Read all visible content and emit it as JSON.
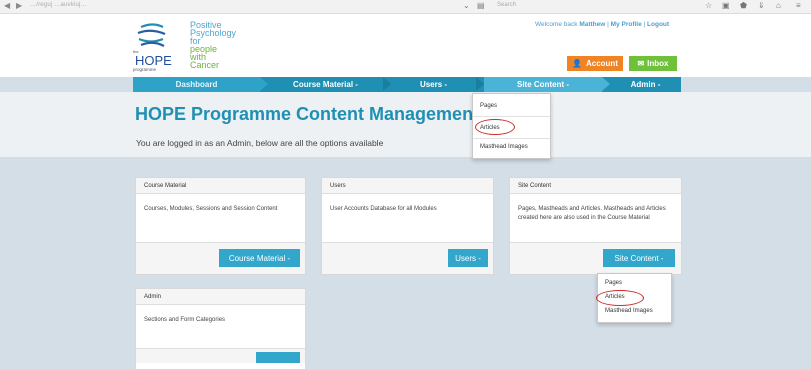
{
  "browser": {
    "url": "…/reguj …auvkiuj…",
    "search_placeholder": "Search"
  },
  "header": {
    "logo": {
      "word": "HOPE",
      "small_top": "the",
      "small_bottom": "programme",
      "tagline": [
        "Positive",
        "Psychology",
        "for",
        "people",
        "with",
        "Cancer"
      ]
    },
    "welcome_prefix": "Welcome back",
    "welcome_user": "Matthew",
    "my_profile": "My Profile",
    "logout": "Logout",
    "sep": "|",
    "account_label": "Account",
    "inbox_label": "Inbox"
  },
  "nav": {
    "items": [
      {
        "label": "Dashboard"
      },
      {
        "label": "Course Material -"
      },
      {
        "label": "Users -"
      },
      {
        "label": "Site Content -"
      },
      {
        "label": "Admin -"
      }
    ],
    "site_content_menu": [
      "Pages",
      "Articles",
      "Masthead Images"
    ]
  },
  "main": {
    "title": "HOPE Programme Content Management S",
    "subtitle": "You are logged in as an Admin, below are all the options available"
  },
  "cards": [
    {
      "title": "Course Material",
      "body": "Courses, Modules, Sessions and Session Content",
      "button": "Course Material -"
    },
    {
      "title": "Users",
      "body": "User Accounts Database for all Modules",
      "button": "Users -"
    },
    {
      "title": "Site Content",
      "body": "Pages, Mastheads and Articles. Mastheads and Articles created here are also used in the Course Material",
      "button": "Site Content -"
    },
    {
      "title": "Admin",
      "body": "Sections and Form Categories",
      "button": ""
    }
  ],
  "card_site_menu": [
    "Pages",
    "Articles",
    "Masthead Images"
  ],
  "colors": {
    "primary": "#1f8fb4",
    "button": "#33a6cc",
    "account": "#f08424",
    "inbox": "#6fc13a",
    "highlight": "#c92d2d"
  }
}
